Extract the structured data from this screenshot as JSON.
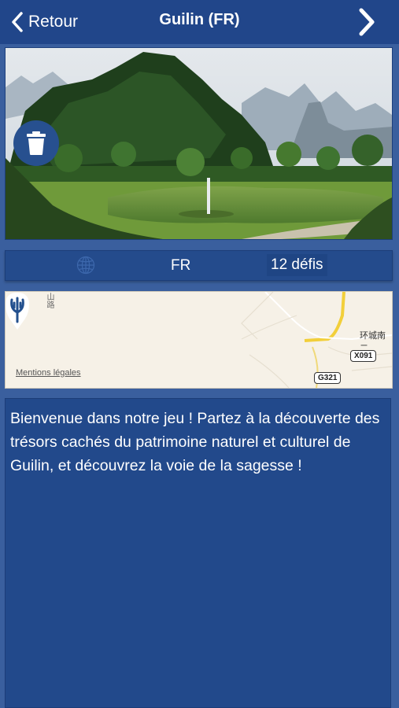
{
  "nav": {
    "back_label": "Retour",
    "title": "Guilin (FR)"
  },
  "hero": {
    "image_icon": "landscape-photo",
    "delete_icon": "trash-icon"
  },
  "info": {
    "language": "FR",
    "challenges": "12 défis",
    "language_icon": "globe-icon"
  },
  "map": {
    "legal_link": "Mentions légales",
    "road_label": "环城南二",
    "vertical_label": "山路",
    "shields": [
      "X091",
      "G321"
    ],
    "pin_icon": "trident-logo-pin"
  },
  "description": {
    "text": "Bienvenue dans notre jeu ! Partez à la découverte des trésors cachés du patrimoine naturel et culturel de Guilin, et découvrez la voie de la sagesse !"
  },
  "colors": {
    "navbar": "#21468a",
    "background": "#3a5f9e",
    "panel": "#22498b"
  }
}
